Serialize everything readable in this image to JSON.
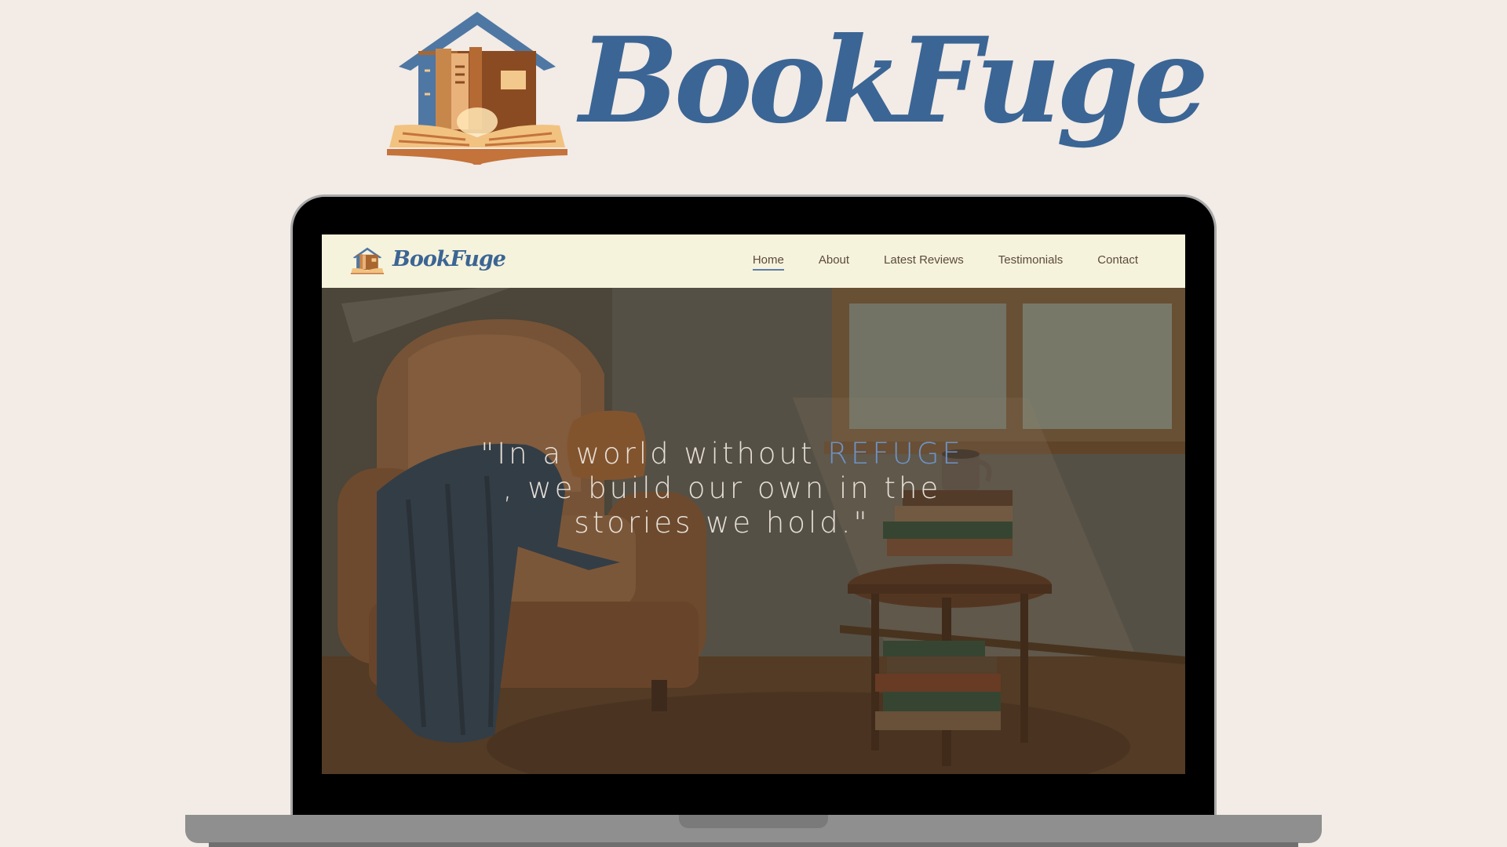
{
  "brand": {
    "name": "BookFuge"
  },
  "site": {
    "brand": "BookFuge",
    "nav": [
      {
        "label": "Home",
        "active": true
      },
      {
        "label": "About"
      },
      {
        "label": "Latest Reviews"
      },
      {
        "label": "Testimonials"
      },
      {
        "label": "Contact"
      }
    ],
    "hero": {
      "quote_before": "\"In a world without ",
      "quote_highlight": "REFUGE",
      "quote_after": " , we build our own in the stories we hold.\""
    }
  },
  "colors": {
    "page_bg": "#f2ebe6",
    "brand_blue": "#3b6594",
    "nav_bg": "#f6f3dc",
    "highlight": "#6e93c8",
    "laptop_frame": "#000000",
    "laptop_base": "#8f8f8f"
  },
  "icons": [
    "bookfuge-house-book-icon"
  ]
}
